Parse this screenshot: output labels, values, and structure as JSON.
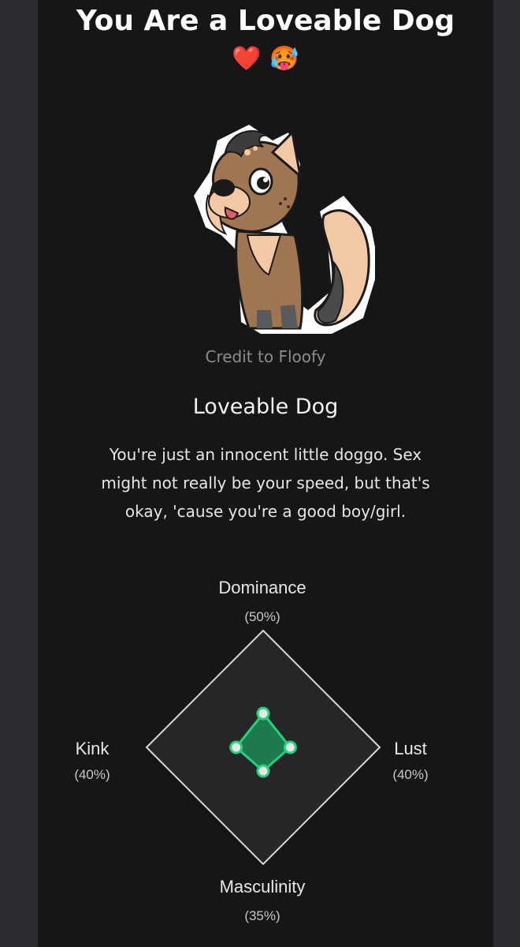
{
  "result": {
    "heading": "You Are a Loveable Dog",
    "heading_emoji": "❤️ 🥵",
    "image_credit": "Credit to Floofy",
    "name": "Loveable Dog",
    "description": "You're just an innocent little doggo. Sex might not really be your speed, but that's okay, 'cause you're a good boy/girl."
  },
  "colors": {
    "page_bg": "#161617",
    "sidebar": "#2b2b30",
    "radar_fill": "#1d7a4c",
    "radar_stroke": "#22d37a",
    "radar_bg": "#262628"
  },
  "chart_data": {
    "type": "radar",
    "axes": [
      {
        "name": "Dominance",
        "label": "(50%)",
        "value": 50
      },
      {
        "name": "Lust",
        "label": "(40%)",
        "value": 40
      },
      {
        "name": "Masculinity",
        "label": "(35%)",
        "value": 35
      },
      {
        "name": "Kink",
        "label": "(40%)",
        "value": 40
      }
    ],
    "range": [
      0,
      100
    ]
  }
}
